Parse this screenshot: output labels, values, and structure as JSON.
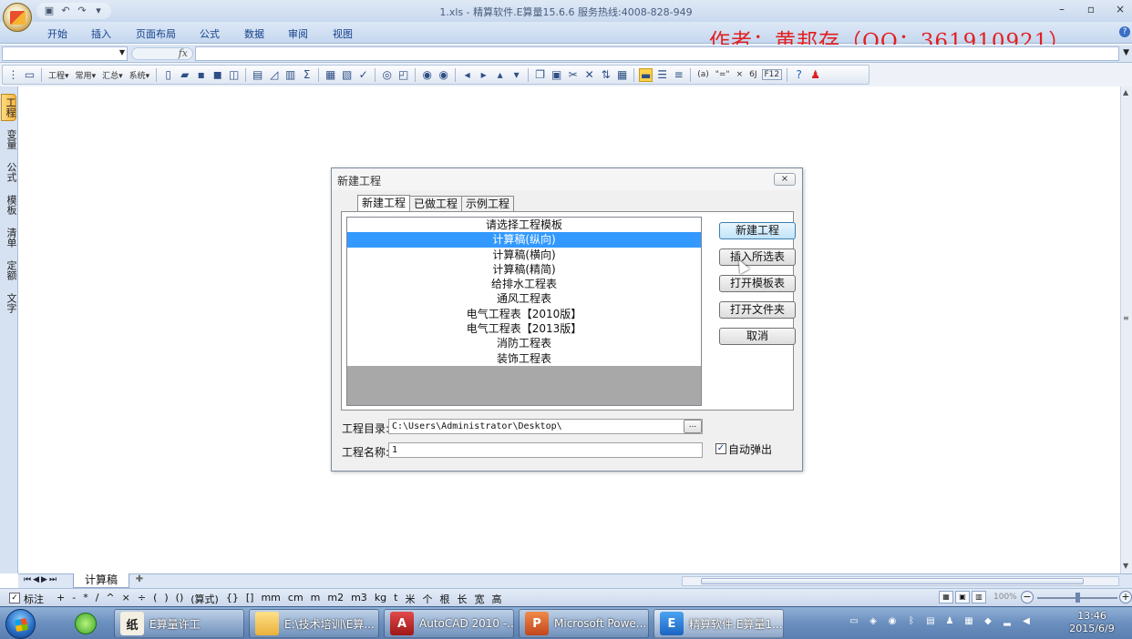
{
  "window": {
    "title": "1.xls - 精算软件.E算量15.6.6 服务热线:4008-828-949",
    "controls": [
      "–",
      "▫",
      "×"
    ]
  },
  "ribbon": {
    "tabs": [
      "开始",
      "插入",
      "页面布局",
      "公式",
      "数据",
      "审阅",
      "视图"
    ]
  },
  "author_watermark": "作者：黄邦存（QQ：361910921）",
  "formula_bar": {
    "fx": "fx"
  },
  "toolbar": {
    "dropdowns": [
      "工程",
      "常用",
      "汇总",
      "系统"
    ],
    "symbols": [
      "(a)",
      "\"=\"",
      "×",
      "6J",
      "F12"
    ]
  },
  "side_tabs": [
    "工程",
    "变量",
    "公式",
    "模板",
    "清单",
    "定额",
    "文字"
  ],
  "sheet": {
    "tab_name": "计算稿"
  },
  "status": {
    "mark_label": "标注",
    "symbols": [
      "+",
      "-",
      "*",
      "/",
      "^",
      "×",
      "÷",
      "(",
      ")",
      "()",
      "(算式)",
      "{}",
      "[]",
      "mm",
      "cm",
      "m",
      "m2",
      "m3",
      "kg",
      "t",
      "米",
      "个",
      "根",
      "长",
      "宽",
      "高"
    ],
    "zoom": "100%"
  },
  "dialog": {
    "title": "新建工程",
    "close": "×",
    "tabs": [
      "新建工程",
      "已做工程",
      "示例工程"
    ],
    "template_list": [
      "请选择工程模板",
      "计算稿(纵向)",
      "计算稿(横向)",
      "计算稿(精简)",
      "给排水工程表",
      "通风工程表",
      "电气工程表【2010版】",
      "电气工程表【2013版】",
      "消防工程表",
      "装饰工程表"
    ],
    "selected_index": 1,
    "buttons": {
      "new_project": "新建工程",
      "insert_selected": "插入所选表",
      "open_template": "打开模板表",
      "open_folder": "打开文件夹",
      "cancel": "取消"
    },
    "dir_label": "工程目录:",
    "dir_value": "C:\\Users\\Administrator\\Desktop\\",
    "browse": "...",
    "name_label": "工程名称:",
    "name_value": "1",
    "auto_popup_label": "自动弹出",
    "auto_popup_checked": true
  },
  "taskbar": {
    "buttons": [
      {
        "label": "E算量许工",
        "icon": "zhi-app-icon"
      },
      {
        "label": "E:\\技术培训\\E算...",
        "icon": "folder-icon"
      },
      {
        "label": "AutoCAD 2010 -...",
        "icon": "autocad-icon"
      },
      {
        "label": "Microsoft Powe...",
        "icon": "powerpoint-icon"
      },
      {
        "label": "精算软件.E算量1...",
        "icon": "e-app-icon"
      }
    ],
    "clock_time": "13:46",
    "clock_date": "2015/6/9"
  },
  "colors": {
    "selection": "#3399ff",
    "author_text": "#e31f1f",
    "ribbon_text": "#15428b"
  }
}
